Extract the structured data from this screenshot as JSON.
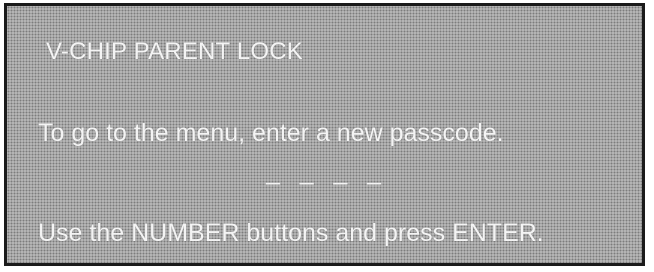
{
  "menu": {
    "title": "V-CHIP PARENT LOCK",
    "instruction": "To go to the menu, enter a new passcode.",
    "passcode_placeholder": "– – – –",
    "hint": "Use the NUMBER buttons and press ENTER."
  },
  "colors": {
    "background": "#a9a9a9",
    "text": "#f4f4f4",
    "border": "#1a1a1a"
  }
}
